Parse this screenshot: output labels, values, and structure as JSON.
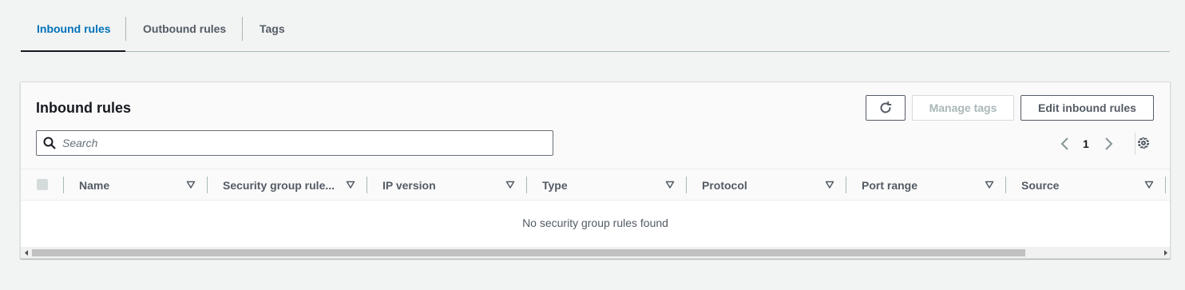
{
  "tabs": [
    {
      "label": "Inbound rules",
      "active": true
    },
    {
      "label": "Outbound rules",
      "active": false
    },
    {
      "label": "Tags",
      "active": false
    }
  ],
  "panel": {
    "title": "Inbound rules",
    "refresh_icon": "refresh-icon",
    "manage_tags_label": "Manage tags",
    "edit_label": "Edit inbound rules",
    "search_placeholder": "Search",
    "search_value": "",
    "page_number": "1",
    "settings_icon": "gear-icon"
  },
  "table": {
    "columns": [
      "Name",
      "Security group rule...",
      "IP version",
      "Type",
      "Protocol",
      "Port range",
      "Source"
    ],
    "empty_message": "No security group rules found"
  },
  "colors": {
    "accent": "#0073bb",
    "text": "#16191f",
    "muted": "#545b64",
    "background": "#f2f3f3"
  }
}
